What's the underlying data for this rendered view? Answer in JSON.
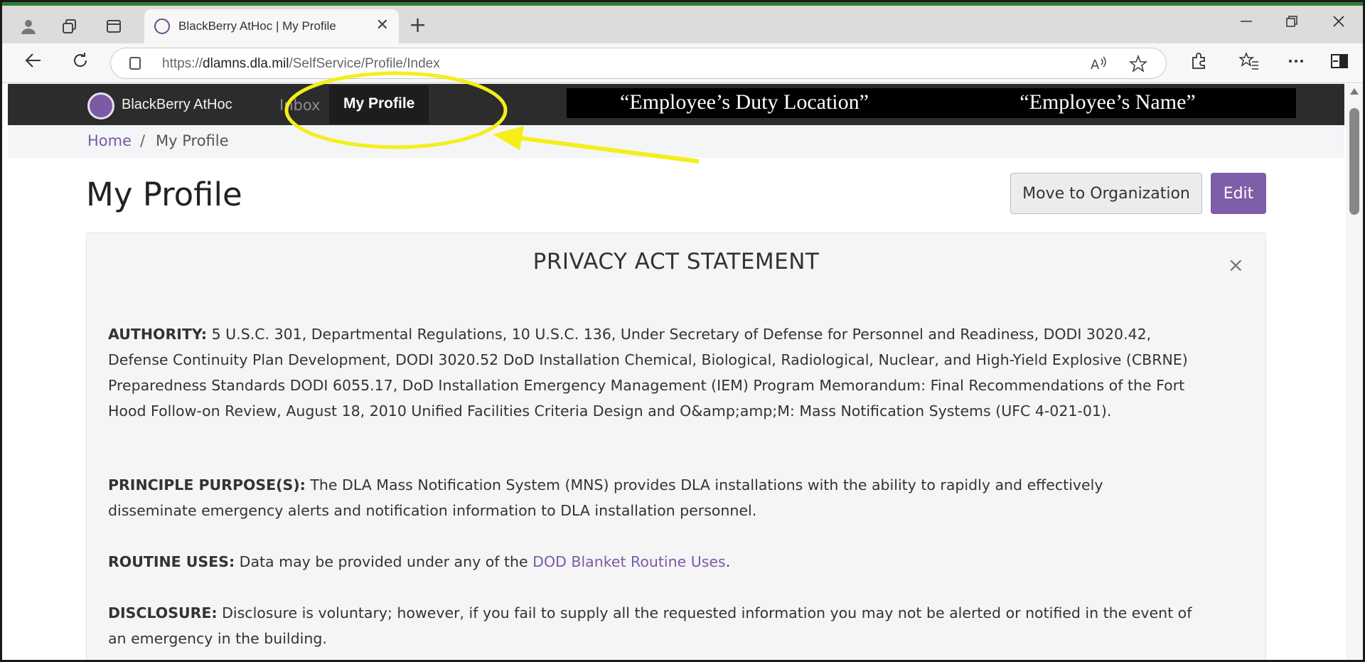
{
  "browser": {
    "tab_title": "BlackBerry AtHoc | My Profile",
    "tab_close": "✕",
    "new_tab": "+",
    "url_prefix": "https://",
    "url_host": "dlamns.dla.mil",
    "url_path": "/SelfService/Profile/Index",
    "icons": [
      "profile-icon",
      "workspaces-icon",
      "tab-actions-icon",
      "back-icon",
      "refresh-icon",
      "read-aloud-icon",
      "favorite-star-icon",
      "extensions-icon",
      "favorites-icon",
      "more-icon",
      "sidebar-icon"
    ]
  },
  "header": {
    "logo_text": "BlackBerry AtHoc",
    "nav": [
      {
        "label": "Inbox"
      },
      {
        "label": "My Profile"
      }
    ],
    "duty_location": "“Employee’s Duty Location”",
    "employee_name": "“Employee’s Name”"
  },
  "breadcrumb": {
    "home": "Home",
    "separator": "/",
    "current": "My Profile"
  },
  "page": {
    "title": "My Profile",
    "move_button": "Move to Organization",
    "edit_button": "Edit"
  },
  "privacy": {
    "title": "PRIVACY ACT STATEMENT",
    "close": "×",
    "authority_label": "AUTHORITY:",
    "authority_text": " 5 U.S.C. 301, Departmental Regulations, 10 U.S.C. 136, Under Secretary of Defense for Personnel and Readiness, DODI 3020.42, Defense Continuity Plan Development, DODI 3020.52 DoD Installation Chemical, Biological, Radiological, Nuclear, and High-Yield Explosive (CBRNE) Preparedness Standards DODI 6055.17, DoD Installation Emergency Management (IEM) Program Memorandum: Final Recommendations of the Fort Hood Follow-on Review, August 18, 2010 Unified Facilities Criteria Design and O&amp;amp;M: Mass Notification Systems (UFC 4-021-01).",
    "purpose_label": "PRINCIPLE PURPOSE(S):",
    "purpose_text": " The DLA Mass Notification System (MNS) provides DLA installations with the ability to rapidly and effectively disseminate emergency alerts and notification information to DLA installation personnel.",
    "routine_label": "ROUTINE USES:",
    "routine_text": " Data may be provided under any of the ",
    "routine_link": "DOD Blanket Routine Uses",
    "routine_end": ".",
    "disclosure_label": "DISCLOSURE:",
    "disclosure_text": " Disclosure is voluntary; however, if you fail to supply all the requested information you may not be alerted or notified in the event of an emergency in the building."
  },
  "colors": {
    "accent_purple": "#7d5ea8",
    "header_dark": "#2c2c2c",
    "annotation_yellow": "#f5ee1a"
  }
}
